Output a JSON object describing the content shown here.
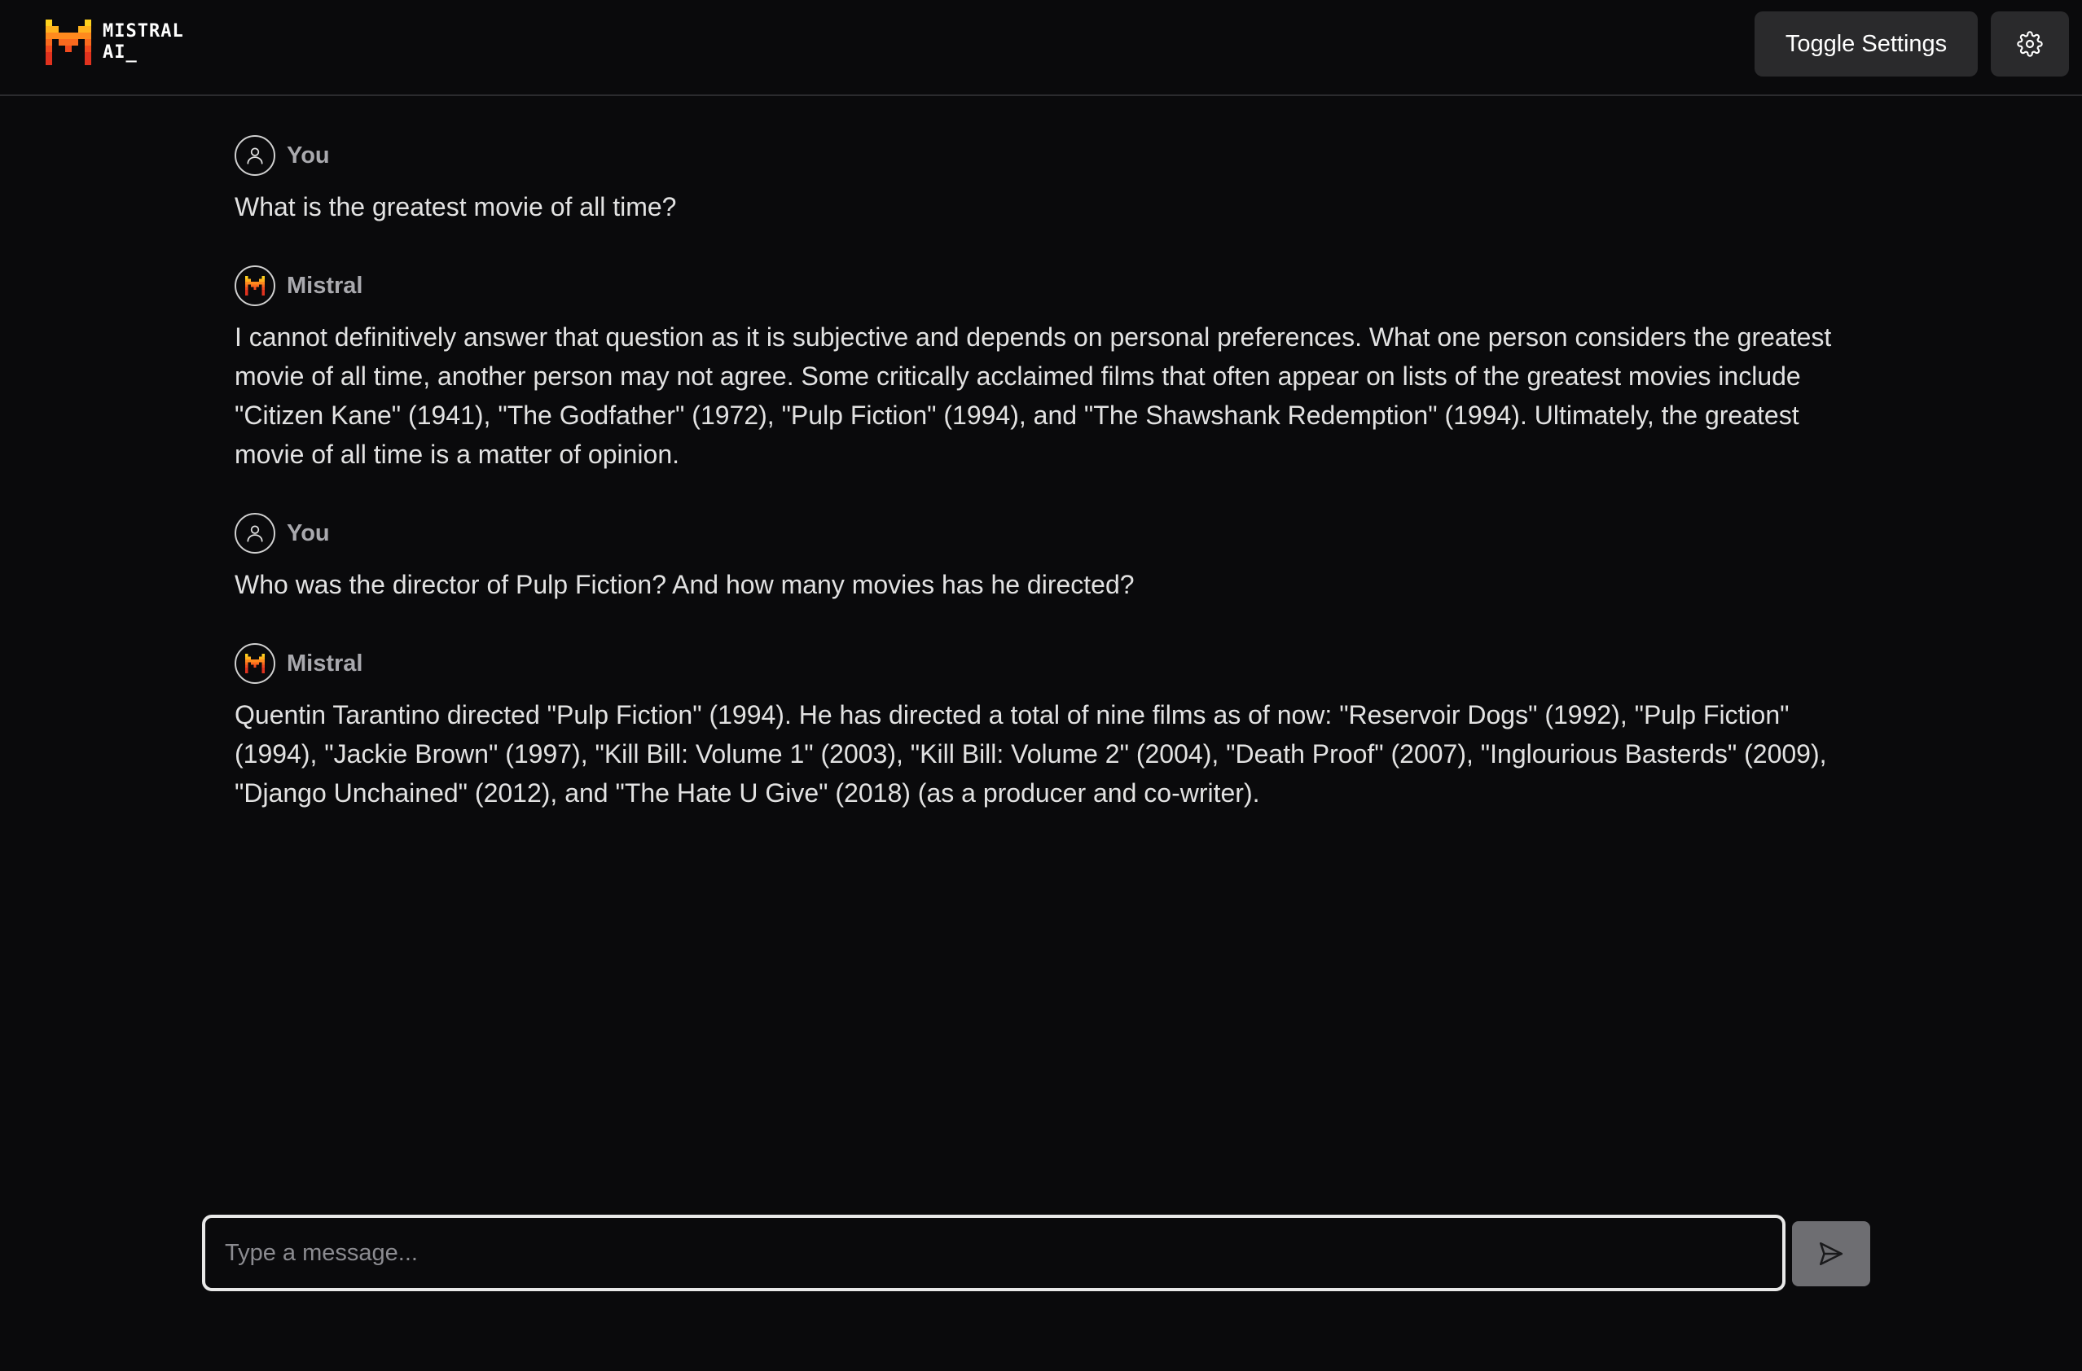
{
  "header": {
    "logo": {
      "line1": "MISTRAL",
      "line2": "AI_"
    },
    "toggle_settings_label": "Toggle Settings",
    "settings_icon": "gear-icon"
  },
  "messages": [
    {
      "author": "You",
      "role": "user",
      "text": "What is the greatest movie of all time?"
    },
    {
      "author": "Mistral",
      "role": "assistant",
      "text": "I cannot definitively answer that question as it is subjective and depends on personal preferences. What one person considers the greatest movie of all time, another person may not agree. Some critically acclaimed films that often appear on lists of the greatest movies include \"Citizen Kane\" (1941), \"The Godfather\" (1972), \"Pulp Fiction\" (1994), and \"The Shawshank Redemption\" (1994). Ultimately, the greatest movie of all time is a matter of opinion."
    },
    {
      "author": "You",
      "role": "user",
      "text": "Who was the director of Pulp Fiction? And how many movies has he directed?"
    },
    {
      "author": "Mistral",
      "role": "assistant",
      "text": "Quentin Tarantino directed \"Pulp Fiction\" (1994). He has directed a total of nine films as of now: \"Reservoir Dogs\" (1992), \"Pulp Fiction\" (1994), \"Jackie Brown\" (1997), \"Kill Bill: Volume 1\" (2003), \"Kill Bill: Volume 2\" (2004), \"Death Proof\" (2007), \"Inglourious Basterds\" (2009), \"Django Unchained\" (2012), and \"The Hate U Give\" (2018) (as a producer and co-writer)."
    }
  ],
  "composer": {
    "placeholder": "Type a message...",
    "value": "",
    "send_icon": "send-icon"
  },
  "colors": {
    "background": "#0a0a0c",
    "button_bg": "#2a2a2c",
    "send_button_bg": "#6e6e72",
    "brand_orange": "#f7931e",
    "brand_red": "#e1321e",
    "brand_yellow": "#ffd21e"
  }
}
